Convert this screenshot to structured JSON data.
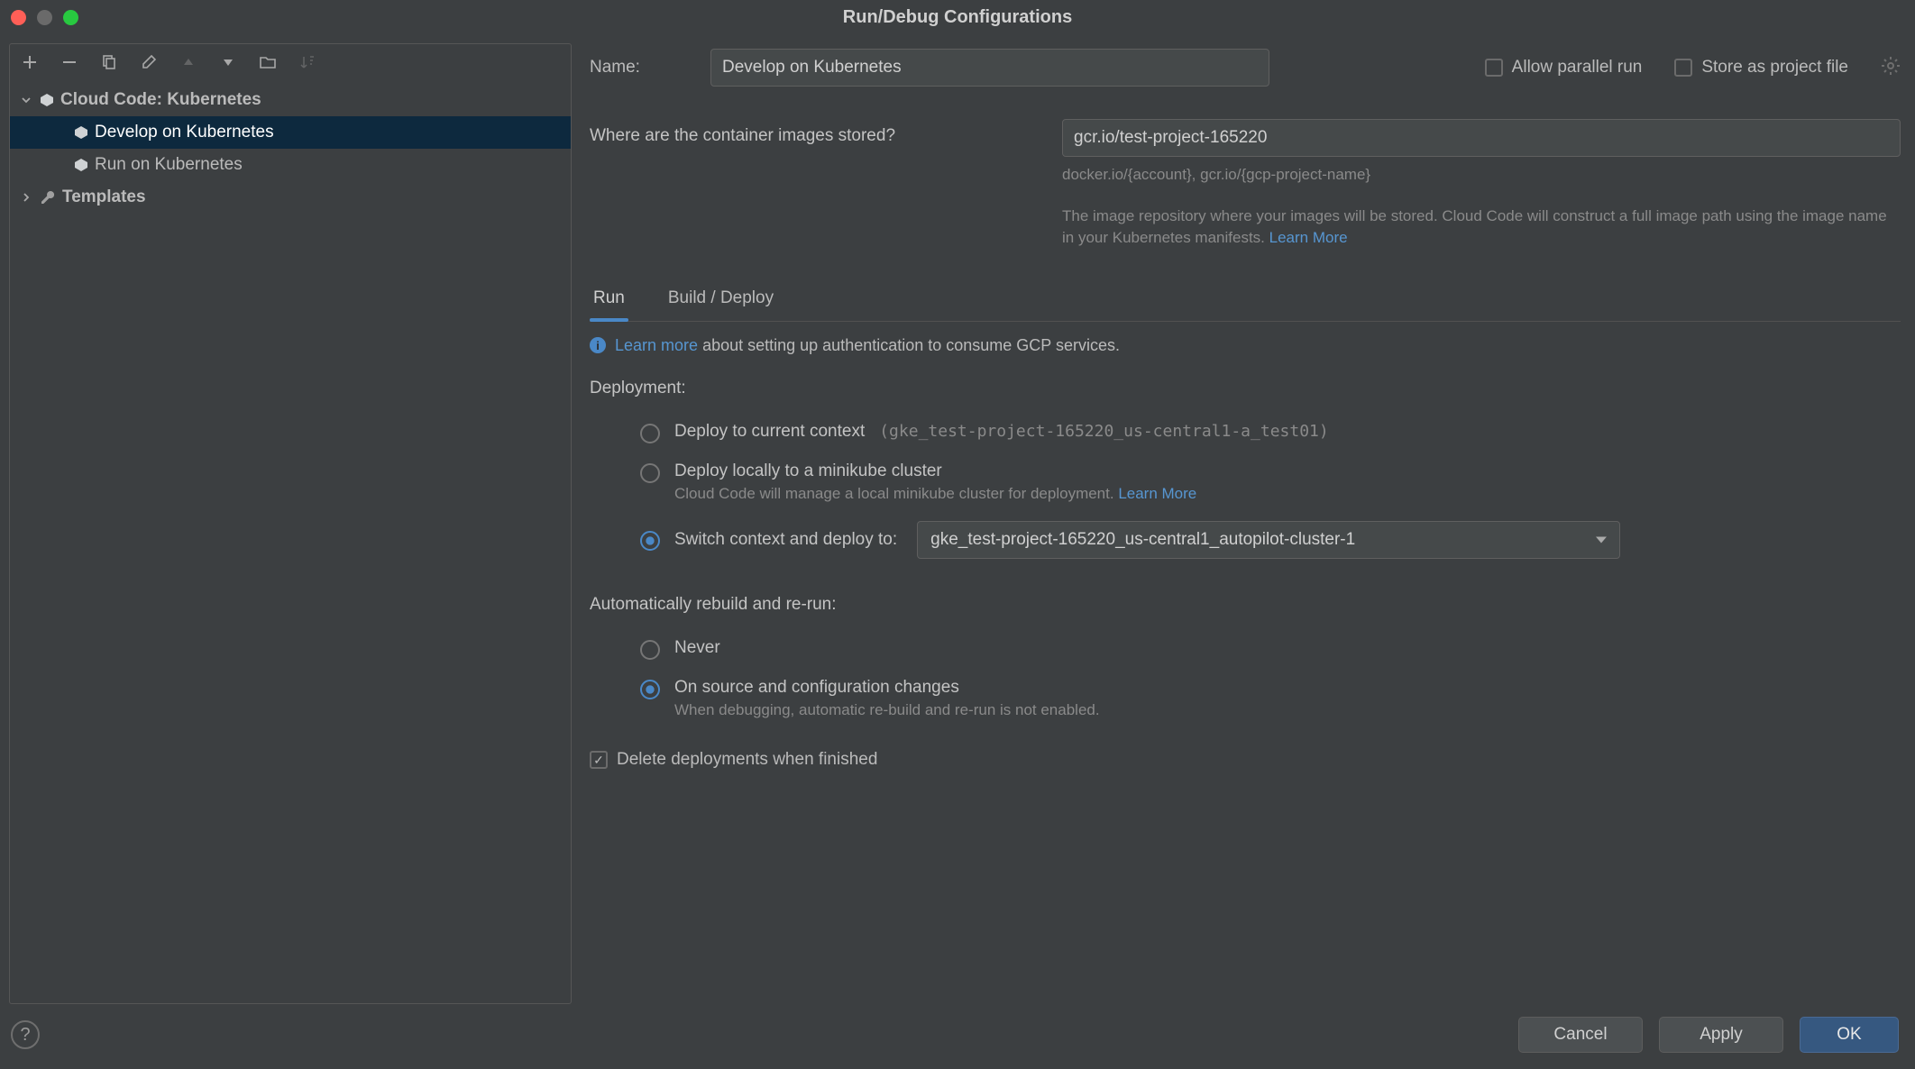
{
  "window": {
    "title": "Run/Debug Configurations"
  },
  "sidebar": {
    "root": {
      "label": "Cloud Code: Kubernetes",
      "children": [
        {
          "label": "Develop on Kubernetes",
          "selected": true
        },
        {
          "label": "Run on Kubernetes"
        }
      ]
    },
    "templates_label": "Templates"
  },
  "form": {
    "name_label": "Name:",
    "name_value": "Develop on Kubernetes",
    "allow_parallel_label": "Allow parallel run",
    "allow_parallel_checked": false,
    "store_project_label": "Store as project file",
    "store_project_checked": false,
    "image_label": "Where are the container images stored?",
    "image_value": "gcr.io/test-project-165220",
    "image_hint": "docker.io/{account}, gcr.io/{gcp-project-name}",
    "image_desc": "The image repository where your images will be stored. Cloud Code will construct a full image path using the image name in your Kubernetes manifests. ",
    "learn_more": "Learn More"
  },
  "tabs": {
    "run": "Run",
    "build": "Build / Deploy",
    "active": "run"
  },
  "info": {
    "link": "Learn more",
    "text": " about setting up authentication to consume GCP services."
  },
  "deployment": {
    "heading": "Deployment:",
    "current_label": "Deploy to current context",
    "current_context": "(gke_test-project-165220_us-central1-a_test01)",
    "minikube_label": "Deploy locally to a minikube cluster",
    "minikube_sub": "Cloud Code will manage a local minikube cluster for deployment. ",
    "minikube_link": "Learn More",
    "switch_label": "Switch context and deploy to:",
    "switch_value": "gke_test-project-165220_us-central1_autopilot-cluster-1"
  },
  "rebuild": {
    "heading": "Automatically rebuild and re-run:",
    "never_label": "Never",
    "onchange_label": "On source and configuration changes",
    "onchange_sub": "When debugging, automatic re-build and re-run is not enabled."
  },
  "delete": {
    "label": "Delete deployments when finished",
    "checked": true
  },
  "footer": {
    "cancel": "Cancel",
    "apply": "Apply",
    "ok": "OK"
  }
}
